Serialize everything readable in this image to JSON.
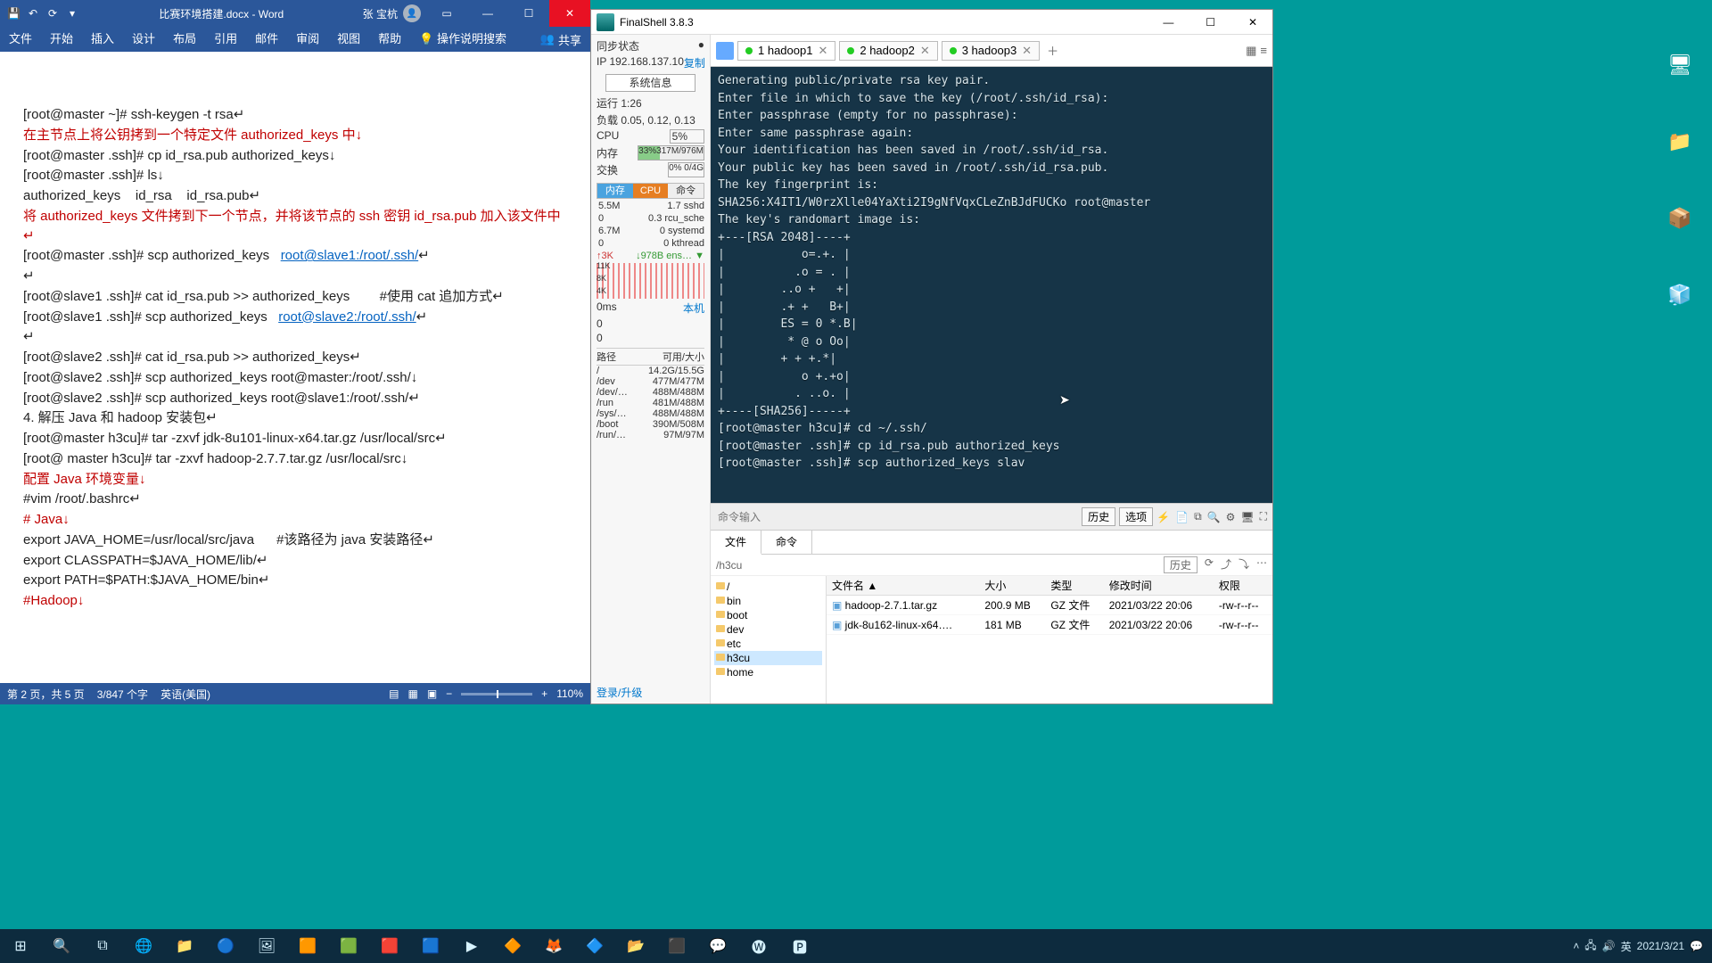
{
  "word": {
    "title": "比赛环境搭建.docx - Word",
    "user": "张 宝杭",
    "ribbon": [
      "文件",
      "开始",
      "插入",
      "设计",
      "布局",
      "引用",
      "邮件",
      "审阅",
      "视图",
      "帮助"
    ],
    "tellme": "操作说明搜索",
    "share": "共享",
    "body": {
      "l1": "[root@master ~]# ssh-keygen -t rsa↵",
      "r1": "在主节点上将公钥拷到一个特定文件 authorized_keys 中↓",
      "l2": "[root@master .ssh]# cp id_rsa.pub authorized_keys↓",
      "l3": "[root@master .ssh]# ls↓",
      "l4": "authorized_keys    id_rsa    id_rsa.pub↵",
      "r2": "将 authorized_keys 文件拷到下一个节点，并将该节点的 ssh 密钥 id_rsa.pub 加入该文件中↵",
      "l5a": "[root@master .ssh]# scp authorized_keys   ",
      "l5b": "root@slave1:/root/.ssh/",
      "l5c": "↵",
      "l6": "↵",
      "l7": "[root@slave1 .ssh]# cat id_rsa.pub >> authorized_keys        #使用 cat 追加方式↵",
      "l8a": "[root@slave1 .ssh]# scp authorized_keys   ",
      "l8b": "root@slave2:/root/.ssh/",
      "l8c": "↵",
      "l9": "↵",
      "l10": "[root@slave2 .ssh]# cat id_rsa.pub >> authorized_keys↵",
      "l11": "[root@slave2 .ssh]# scp authorized_keys root@master:/root/.ssh/↓",
      "l12": "[root@slave2 .ssh]# scp authorized_keys root@slave1:/root/.ssh/↵",
      "l13": "",
      "l14": "4. 解压 Java 和 hadoop 安装包↵",
      "l15": "[root@master h3cu]# tar -zxvf jdk-8u101-linux-x64.tar.gz /usr/local/src↵",
      "l16": "[root@ master h3cu]# tar -zxvf hadoop-2.7.7.tar.gz /usr/local/src↓",
      "l17": "",
      "r3": "配置 Java 环境变量↓",
      "l18": "#vim /root/.bashrc↵",
      "r4": "# Java↓",
      "l19": "export JAVA_HOME=/usr/local/src/java      #该路径为 java 安装路径↵",
      "l20": "export CLASSPATH=$JAVA_HOME/lib/↵",
      "l21": "export PATH=$PATH:$JAVA_HOME/bin↵",
      "r5": "#Hadoop↓"
    },
    "status_page": "第 2 页，共 5 页",
    "status_words": "3/847 个字",
    "status_lang": "英语(美国)",
    "zoom": "110%"
  },
  "fs": {
    "title": "FinalShell 3.8.3",
    "sync": "同步状态",
    "ip": "IP 192.168.137.10",
    "copy": "复制",
    "sysinfo": "系统信息",
    "run": "运行 1:26",
    "load": "负载 0.05, 0.12, 0.13",
    "cpu_label": "CPU",
    "cpu_val": "5%",
    "mem_label": "内存",
    "mem_val": "33%317M/976M",
    "swap_label": "交换",
    "swap_val": "0%           0/4G",
    "tab_mem": "内存",
    "tab_cpu": "CPU",
    "tab_cmd": "命令",
    "m1a": "5.5M",
    "m1b": "1.7 sshd",
    "m2a": "0",
    "m2b": "0.3 rcu_sche",
    "m3a": "6.7M",
    "m3b": "0 systemd",
    "m4a": "0",
    "m4b": "0 kthread",
    "net_up": "↑3K",
    "net_dn": "↓978B ens… ▼",
    "scaleK": "11K",
    "scale8": "8K",
    "scale4": "4K",
    "ping": "0ms",
    "host": "本机",
    "z1": "0",
    "z2": "0",
    "p_hdr_l": "路径",
    "p_hdr_r": "可用/大小",
    "p1l": "/",
    "p1r": "14.2G/15.5G",
    "p2l": "/dev",
    "p2r": "477M/477M",
    "p3l": "/dev/…",
    "p3r": "488M/488M",
    "p4l": "/run",
    "p4r": "481M/488M",
    "p5l": "/sys/…",
    "p5r": "488M/488M",
    "p6l": "/boot",
    "p6r": "390M/508M",
    "p7l": "/run/…",
    "p7r": "97M/97M",
    "login": "登录/升级",
    "tabs": [
      {
        "n": "1 hadoop1"
      },
      {
        "n": "2 hadoop2"
      },
      {
        "n": "3 hadoop3"
      }
    ],
    "term": "Generating public/private rsa key pair.\nEnter file in which to save the key (/root/.ssh/id_rsa):\nEnter passphrase (empty for no passphrase):\nEnter same passphrase again:\nYour identification has been saved in /root/.ssh/id_rsa.\nYour public key has been saved in /root/.ssh/id_rsa.pub.\nThe key fingerprint is:\nSHA256:X4IT1/W0rzXlle04YaXti2I9gNfVqxCLeZnBJdFUCKo root@master\nThe key's randomart image is:\n+---[RSA 2048]----+\n|           o=.+. |\n|          .o = . |\n|        ..o +   +|\n|        .+ +   B+|\n|        ES = 0 *.B|\n|         * @ o Oo|\n|        + + +.*|\n|           o +.+o|\n|          . ..o. |\n+----[SHA256]-----+\n[root@master h3cu]# cd ~/.ssh/\n[root@master .ssh]# cp id_rsa.pub authorized_keys\n[root@master .ssh]# scp authorized_keys slav",
    "cmd_ph": "命令输入",
    "btn_hist": "历史",
    "btn_opt": "选项",
    "bt_files": "文件",
    "bt_cmds": "命令",
    "path": "/h3cu",
    "btn_hist2": "历史",
    "tree": [
      "/",
      "bin",
      "boot",
      "dev",
      "etc",
      "h3cu",
      "home"
    ],
    "cols": {
      "name": "文件名 ▲",
      "size": "大小",
      "type": "类型",
      "mtime": "修改时间",
      "perm": "权限"
    },
    "rows": [
      {
        "name": "hadoop-2.7.1.tar.gz",
        "size": "200.9 MB",
        "type": "GZ 文件",
        "mtime": "2021/03/22 20:06",
        "perm": "-rw-r--r--"
      },
      {
        "name": "jdk-8u162-linux-x64….",
        "size": "181 MB",
        "type": "GZ 文件",
        "mtime": "2021/03/22 20:06",
        "perm": "-rw-r--r--"
      }
    ]
  },
  "taskbar": {
    "time": "2021/3/21",
    "ime": "英"
  }
}
